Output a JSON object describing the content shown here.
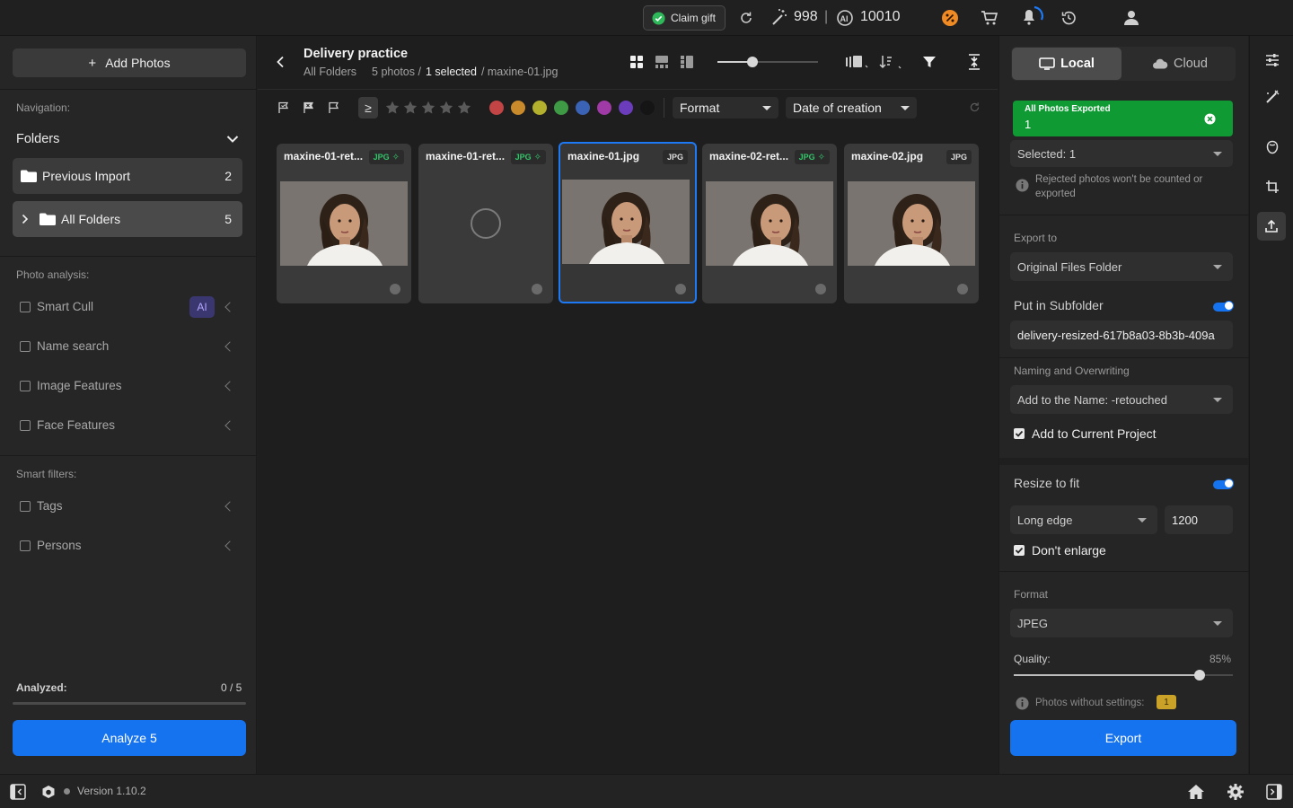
{
  "topbar": {
    "claim_gift": "Claim gift",
    "credits": "998",
    "divider": "|",
    "ai_credits": "10010"
  },
  "sidebar": {
    "add_photos": "Add Photos",
    "navigation_label": "Navigation:",
    "folders_label": "Folders",
    "items": [
      {
        "label": "Previous Import",
        "count": "2"
      },
      {
        "label": "All Folders",
        "count": "5"
      }
    ],
    "photo_analysis_label": "Photo analysis:",
    "analysis": [
      {
        "label": "Smart Cull",
        "badge": "AI"
      },
      {
        "label": "Name search"
      },
      {
        "label": "Image Features"
      },
      {
        "label": "Face Features"
      }
    ],
    "smart_filters_label": "Smart filters:",
    "filters": [
      {
        "label": "Tags"
      },
      {
        "label": "Persons"
      }
    ],
    "analyzed_label": "Analyzed:",
    "analyzed_value": "0 / 5",
    "analyzed_progress": 0,
    "analyze_button": "Analyze 5"
  },
  "header": {
    "title": "Delivery practice",
    "breadcrumb_root": "All Folders",
    "photos_count": "5 photos /",
    "selected": "1 selected",
    "current_file": "/ maxine-01.jpg"
  },
  "filterbar": {
    "rating_op": "≥",
    "label_colors": [
      "#c24444",
      "#c88a2a",
      "#b3b02d",
      "#3f9a45",
      "#3b63b5",
      "#a03aa6",
      "#6b3dbd",
      "#151515"
    ],
    "format_dropdown": "Format",
    "sort_dropdown": "Date of creation"
  },
  "photos": [
    {
      "name": "maxine-01-ret...",
      "format": "JPG",
      "tag": "green",
      "state": "thumb"
    },
    {
      "name": "maxine-01-ret...",
      "format": "JPG",
      "tag": "green",
      "state": "loading"
    },
    {
      "name": "maxine-01.jpg",
      "format": "JPG",
      "tag": "plain",
      "state": "selected"
    },
    {
      "name": "maxine-02-ret...",
      "format": "JPG",
      "tag": "green",
      "state": "thumb"
    },
    {
      "name": "maxine-02.jpg",
      "format": "JPG",
      "tag": "plain",
      "state": "thumb"
    }
  ],
  "export_panel": {
    "tab_local": "Local",
    "tab_cloud": "Cloud",
    "toast_title": "All Photos Exported",
    "toast_value": "1",
    "selected_dropdown": "Selected: 1",
    "rejected_note": "Rejected photos won't be counted or exported",
    "export_to_label": "Export to",
    "export_to_value": "Original Files Folder",
    "subfolder_label": "Put in Subfolder",
    "subfolder_value": "delivery-resized-617b8a03-8b3b-409a",
    "naming_label": "Naming and Overwriting",
    "naming_value": "Add to the Name: -retouched",
    "add_project_label": "Add to Current Project",
    "resize_label": "Resize to fit",
    "resize_mode": "Long edge",
    "resize_value": "1200",
    "dont_enlarge": "Don't enlarge",
    "format_label": "Format",
    "format_value": "JPEG",
    "quality_label": "Quality:",
    "quality_value": "85%",
    "quality_level": 0.85,
    "no_settings_label": "Photos without settings:",
    "no_settings_count": "1",
    "export_button": "Export"
  },
  "footer": {
    "version": "Version 1.10.2"
  }
}
